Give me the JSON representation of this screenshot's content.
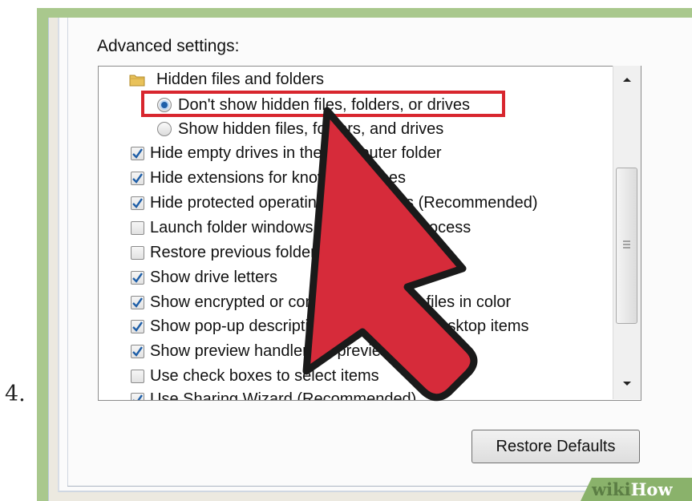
{
  "step_number": "4.",
  "advanced_settings_label": "Advanced settings:",
  "settings_items": [
    {
      "type": "folder",
      "label": "Hidden files and folders"
    },
    {
      "type": "radio",
      "label": "Don't show hidden files, folders, or drives",
      "checked": true
    },
    {
      "type": "radio",
      "label": "Show hidden files, folders, and drives",
      "checked": false
    },
    {
      "type": "checkbox",
      "label": "Hide empty drives in the Computer folder",
      "checked": true
    },
    {
      "type": "checkbox",
      "label": "Hide extensions for known file types",
      "checked": true
    },
    {
      "type": "checkbox",
      "label": "Hide protected operating system files (Recommended)",
      "checked": true
    },
    {
      "type": "checkbox",
      "label": "Launch folder windows in a separate process",
      "checked": false
    },
    {
      "type": "checkbox",
      "label": "Restore previous folder windows at logon",
      "checked": false
    },
    {
      "type": "checkbox",
      "label": "Show drive letters",
      "checked": true
    },
    {
      "type": "checkbox",
      "label": "Show encrypted or compressed NTFS files in color",
      "checked": true
    },
    {
      "type": "checkbox",
      "label": "Show pop-up description for folder and desktop items",
      "checked": true
    },
    {
      "type": "checkbox",
      "label": "Show preview handlers in preview pane",
      "checked": true
    },
    {
      "type": "checkbox",
      "label": "Use check boxes to select items",
      "checked": false
    },
    {
      "type": "checkbox",
      "label": "Use Sharing Wizard (Recommended)",
      "checked": true
    }
  ],
  "restore_defaults_label": "Restore Defaults",
  "watermark": {
    "wiki": "wiki",
    "how": "How"
  },
  "colors": {
    "highlight": "#d8262e",
    "arrow_fill": "#d62b3a",
    "arrow_outline": "#1a1a1a",
    "frame_green": "#a9c88d",
    "radio_selected": "#1f5fa8"
  },
  "icons": {
    "checkmark": "checkmark-icon",
    "folder": "folder-icon",
    "scroll_up": "scroll-up-arrow-icon",
    "scroll_down": "scroll-down-arrow-icon",
    "pointer": "pointer-arrow-icon"
  }
}
